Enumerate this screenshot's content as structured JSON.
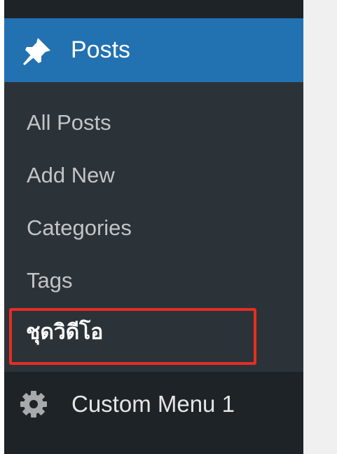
{
  "menu": {
    "posts": {
      "label": "Posts",
      "icon": "pushpin-icon"
    },
    "submenu": [
      {
        "label": "All Posts"
      },
      {
        "label": "Add New"
      },
      {
        "label": "Categories"
      },
      {
        "label": "Tags"
      },
      {
        "label": "ชุดวิดีโอ",
        "current": true
      }
    ],
    "custom": {
      "label": "Custom Menu 1",
      "icon": "gear-icon"
    }
  },
  "colors": {
    "sidebar_bg": "#2c3338",
    "sidebar_dark": "#1d2327",
    "active_blue": "#2271b1",
    "submenu_text": "#c3c4c7",
    "highlight": "#e52d24",
    "content_bg": "#f0f0f1"
  }
}
